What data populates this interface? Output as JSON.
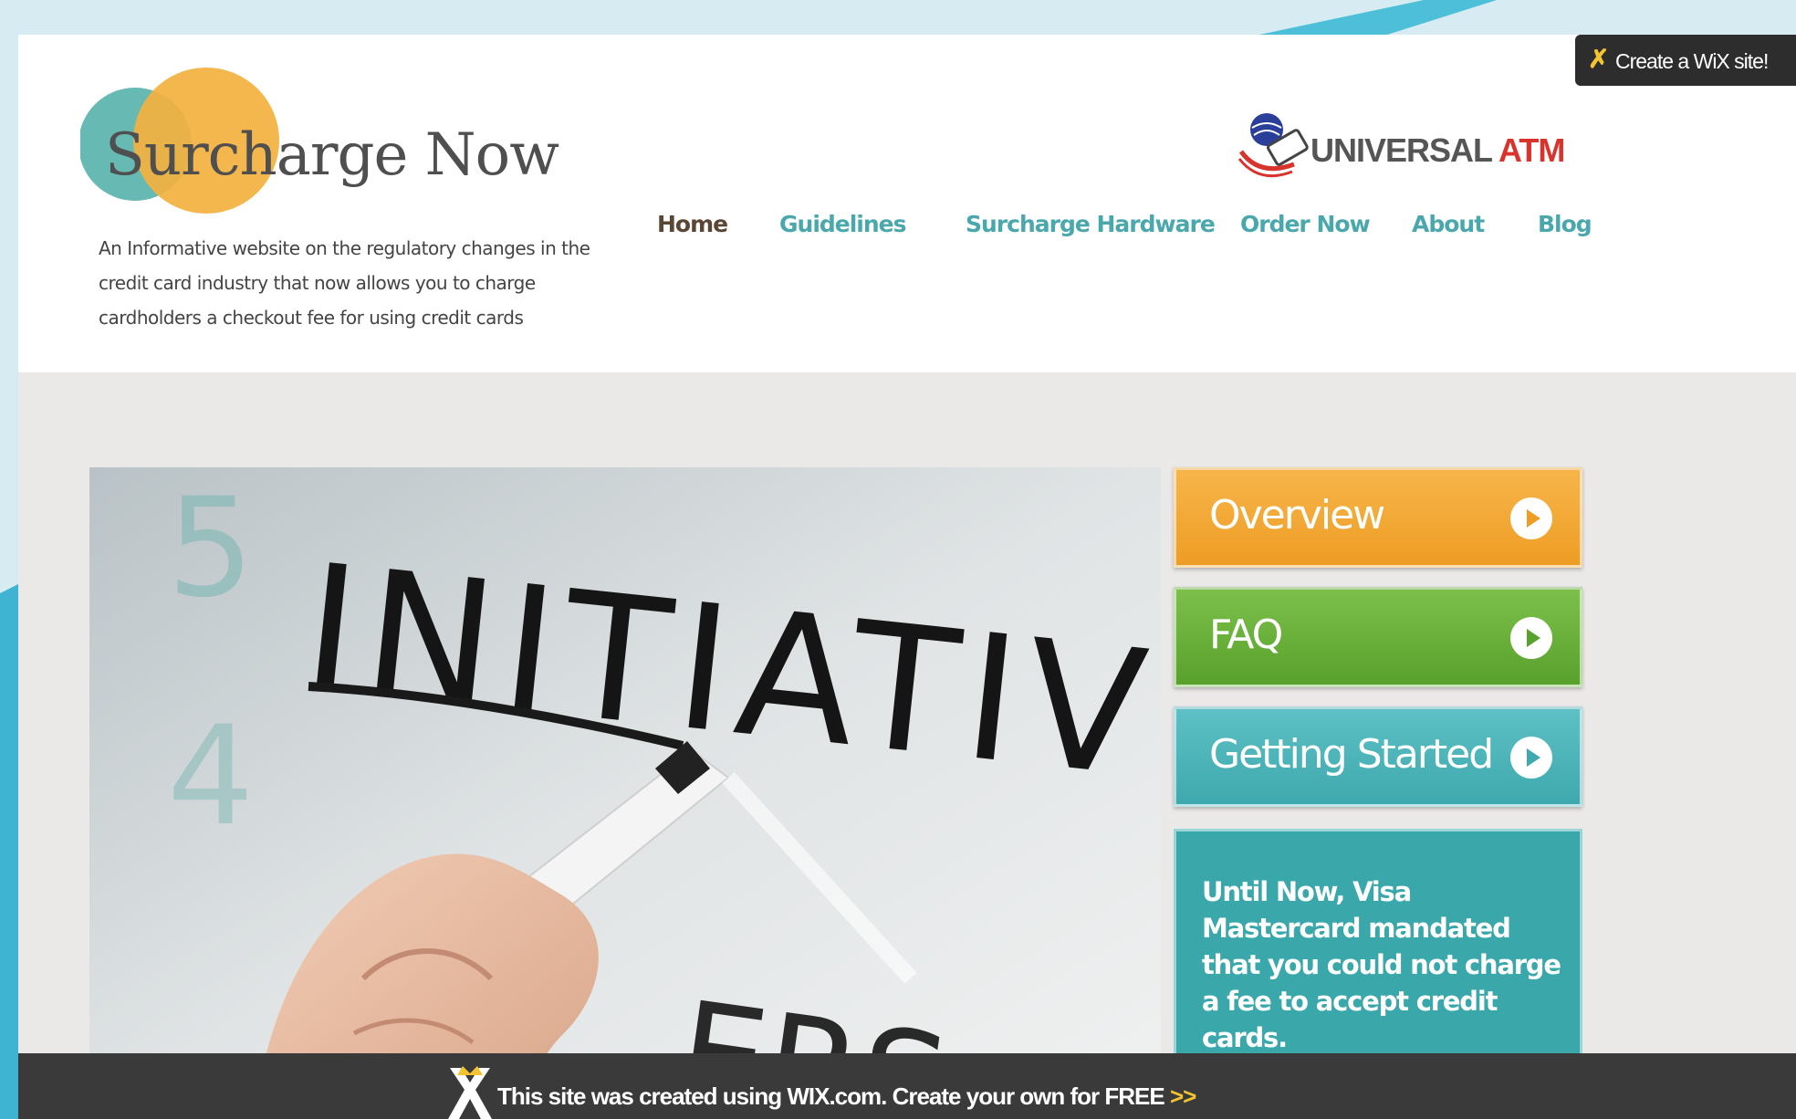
{
  "site": {
    "logo_text": "Surcharge Now",
    "tagline": "An Informative website on the regulatory changes in the credit card industry that now allows you to charge cardholders a checkout fee for using credit cards"
  },
  "partner_logo": {
    "text_main": "UNIVERSAL",
    "text_accent": "ATM"
  },
  "nav": {
    "items": [
      {
        "label": "Home",
        "active": true
      },
      {
        "label": "Guidelines",
        "active": false
      },
      {
        "label": "Surcharge Hardware",
        "active": false
      },
      {
        "label": "Order Now",
        "active": false
      },
      {
        "label": "About",
        "active": false
      },
      {
        "label": "Blog",
        "active": false
      }
    ]
  },
  "side_buttons": {
    "overview": "Overview",
    "faq": "FAQ",
    "getting_started": "Getting Started"
  },
  "info_box": {
    "text": "Until Now, Visa Mastercard mandated that you could not charge a fee to accept credit cards."
  },
  "hero": {
    "word": "INITIATIVE"
  },
  "wix": {
    "badge_label": "Create a WiX site!",
    "banner_text": "This site was created using WIX.com. Create your own for FREE",
    "banner_arrows": ">>"
  },
  "colors": {
    "teal": "#4aa8ad",
    "orange": "#ee9d24",
    "green": "#58a12c",
    "nav_active": "#5a4633",
    "atm_red": "#d8332c"
  }
}
